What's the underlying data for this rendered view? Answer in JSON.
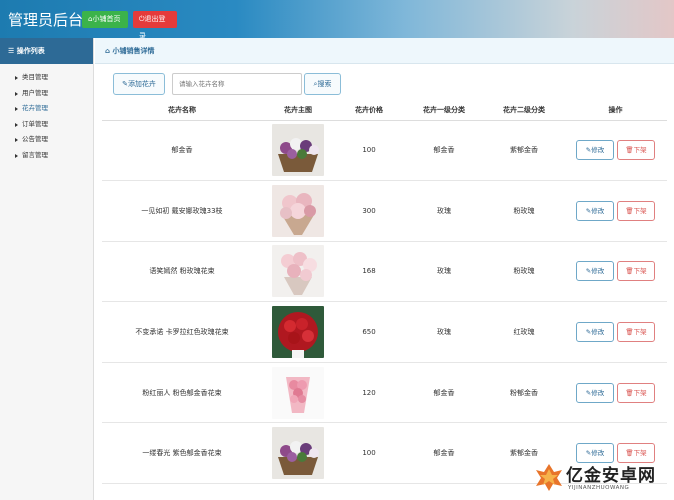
{
  "header": {
    "title": "管理员后台",
    "home_button": "小铺首页",
    "logout_button": "退出登录"
  },
  "sidebar": {
    "title": "操作列表",
    "items": [
      {
        "label": "类目管理"
      },
      {
        "label": "用户管理"
      },
      {
        "label": "花卉管理"
      },
      {
        "label": "订单管理"
      },
      {
        "label": "公告管理"
      },
      {
        "label": "留言管理"
      }
    ]
  },
  "breadcrumb": "小铺销售详情",
  "toolbar": {
    "add_label": "添加花卉",
    "search_placeholder": "请输入花卉名称",
    "search_label": "搜索"
  },
  "table": {
    "headers": [
      "花卉名称",
      "花卉主图",
      "花卉价格",
      "花卉一级分类",
      "花卉二级分类",
      "操作"
    ],
    "rows": [
      {
        "name": "郁金香",
        "price": "100",
        "cat1": "郁金香",
        "cat2": "紫郁金香",
        "image": "purple-flower-basket"
      },
      {
        "name": "一见如初 戴安娜玫瑰33枝",
        "price": "300",
        "cat1": "玫瑰",
        "cat2": "粉玫瑰",
        "image": "pink-rose-bouquet"
      },
      {
        "name": "语笑嫣然 粉玫瑰花束",
        "price": "168",
        "cat1": "玫瑰",
        "cat2": "粉玫瑰",
        "image": "pink-rose-bouquet-light"
      },
      {
        "name": "不变承诺 卡罗拉红色玫瑰花束",
        "price": "650",
        "cat1": "玫瑰",
        "cat2": "红玫瑰",
        "image": "red-rose-bouquet"
      },
      {
        "name": "粉红丽人 粉色郁金香花束",
        "price": "120",
        "cat1": "郁金香",
        "cat2": "粉郁金香",
        "image": "pink-tulip-bouquet"
      },
      {
        "name": "一缕春光 紫色郁金香花束",
        "price": "100",
        "cat1": "郁金香",
        "cat2": "紫郁金香",
        "image": "purple-flower-basket"
      }
    ],
    "edit_label": "修改",
    "delete_label": "下架"
  },
  "watermark": {
    "text": "亿金安卓网",
    "sub": "YIJINANZHUOWANG"
  }
}
